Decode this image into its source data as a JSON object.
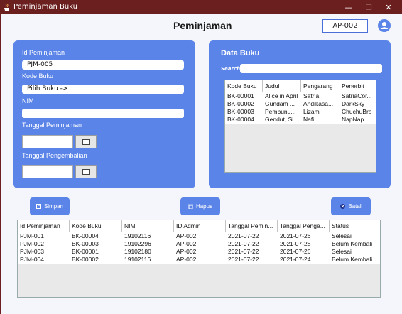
{
  "window": {
    "title": "Peminjaman Buku",
    "min_glyph": "—",
    "max_glyph": "☐",
    "close_glyph": "✕"
  },
  "header": {
    "page_title": "Peminjaman",
    "admin_id": "AP-002"
  },
  "form": {
    "id_label": "Id Peminjaman",
    "id_value": "PJM-005",
    "kode_label": "Kode Buku",
    "kode_value": "Pilih Buku ->",
    "nim_label": "NIM",
    "nim_value": "",
    "tgl_pinjam_label": "Tanggal Peminjaman",
    "tgl_kembali_label": "Tanggal Pengembalian"
  },
  "books": {
    "title": "Data Buku",
    "search_label": "Search",
    "search_value": "",
    "columns": [
      "Kode Buku",
      "Judul",
      "Pengarang",
      "Penerbit"
    ],
    "rows": [
      [
        "BK-00001",
        "Alice in April",
        "Satria",
        "SatriaCor..."
      ],
      [
        "BK-00002",
        "Gundam ...",
        "Andikasa...",
        "DarkSky"
      ],
      [
        "BK-00003",
        "Pembunu...",
        "Lizam",
        "ChuchuBro"
      ],
      [
        "BK-00004",
        "Gendut, Si...",
        "Nafi",
        "NapNap"
      ]
    ]
  },
  "buttons": {
    "simpan": "Simpan",
    "hapus": "Hapus",
    "batal": "Batal"
  },
  "loans": {
    "columns": [
      "Id Peminjaman",
      "Kode Buku",
      "NIM",
      "ID Admin",
      "Tanggal Pemin...",
      "Tanggal Penge...",
      "Status"
    ],
    "rows": [
      [
        "PJM-001",
        "BK-00004",
        "19102116",
        "AP-002",
        "2021-07-22",
        "2021-07-26",
        "Selesai"
      ],
      [
        "PJM-002",
        "BK-00003",
        "19102296",
        "AP-002",
        "2021-07-22",
        "2021-07-28",
        "Belum Kembali"
      ],
      [
        "PJM-003",
        "BK-00001",
        "19102180",
        "AP-002",
        "2021-07-22",
        "2021-07-26",
        "Selesai"
      ],
      [
        "PJM-004",
        "BK-00002",
        "19102116",
        "AP-002",
        "2021-07-22",
        "2021-07-24",
        "Belum Kembali"
      ]
    ]
  },
  "colors": {
    "accent": "#5b84e8",
    "titlebar": "#6b1f1f",
    "background": "#f5f6fb"
  }
}
